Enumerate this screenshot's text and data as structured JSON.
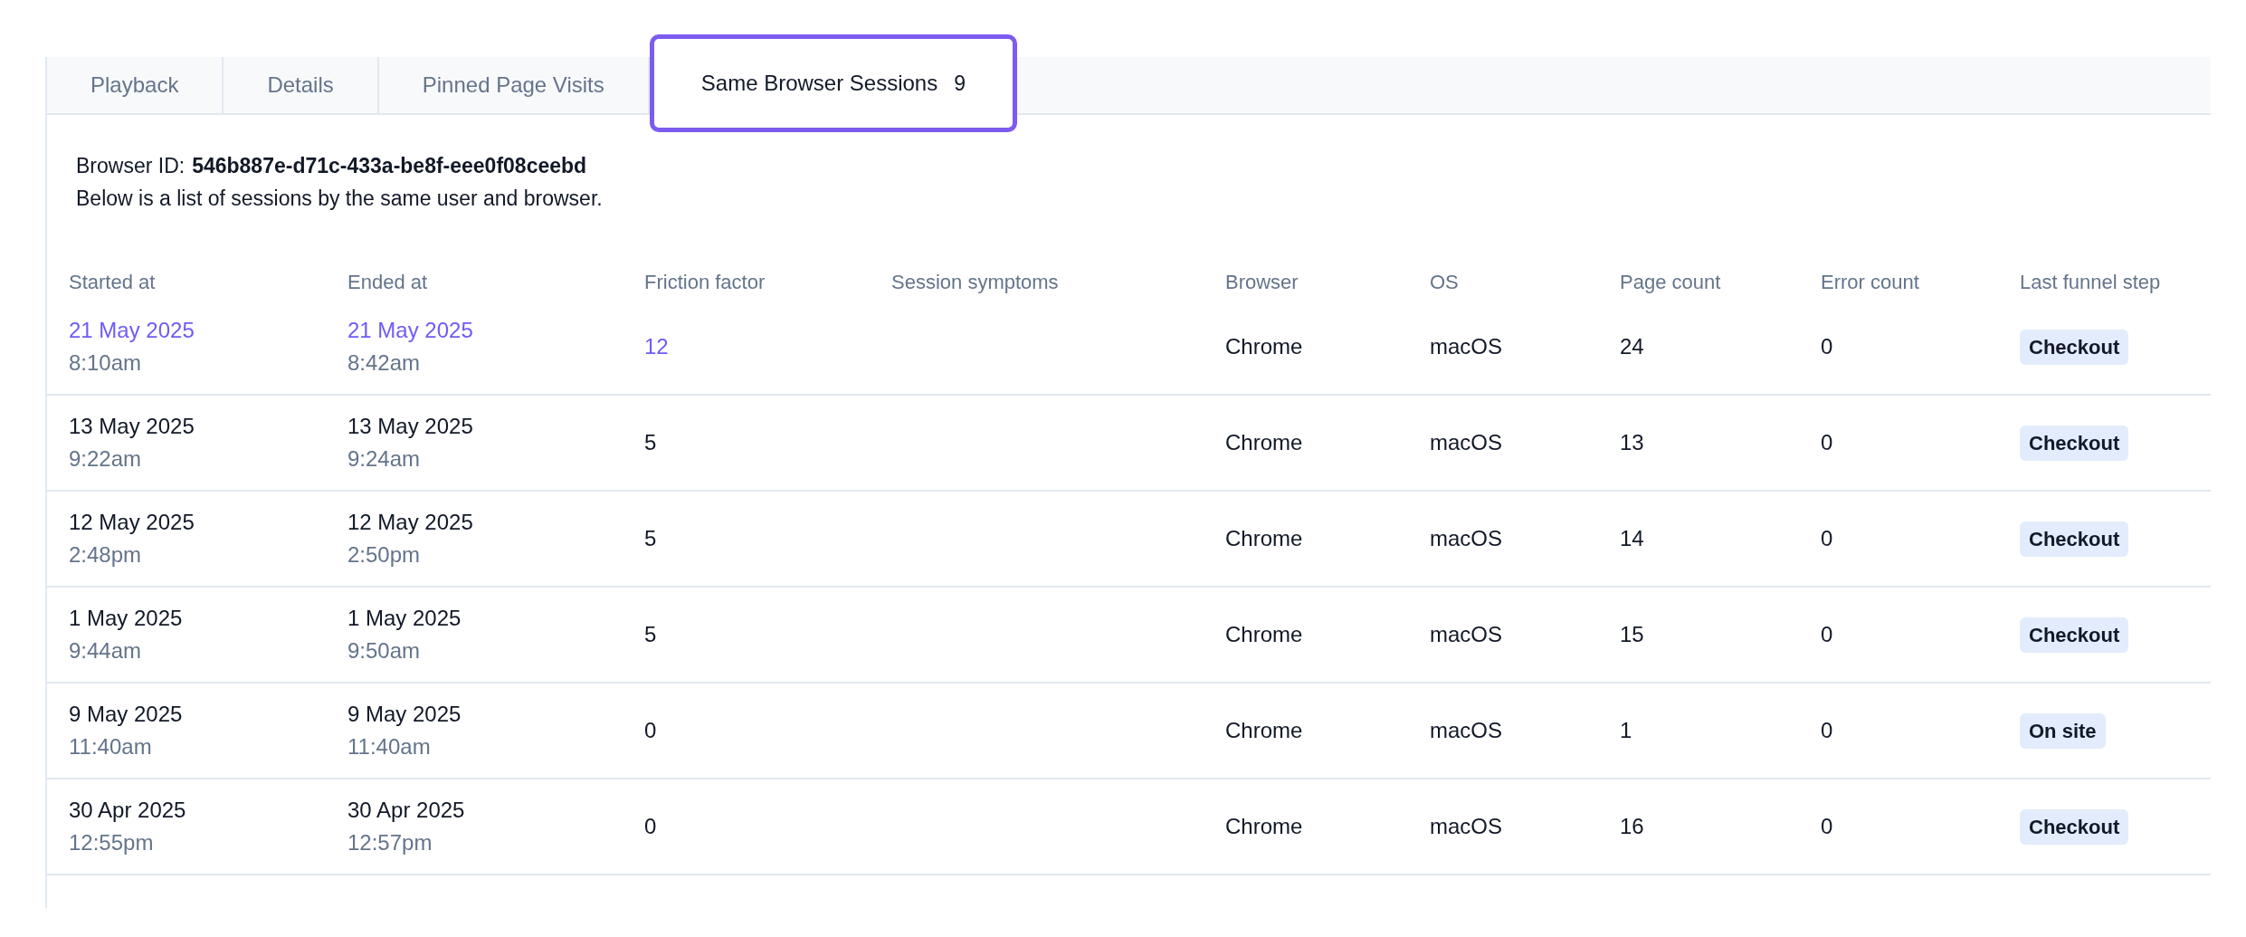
{
  "tabs": [
    {
      "label": "Playback",
      "selected": false
    },
    {
      "label": "Details",
      "selected": false
    },
    {
      "label": "Pinned Page Visits",
      "selected": false
    },
    {
      "label": "Same Browser Sessions",
      "count": "9",
      "selected": true
    }
  ],
  "browser_id": {
    "label": "Browser ID:",
    "value": "546b887e-d71c-433a-be8f-eee0f08ceebd"
  },
  "description": "Below is a list of sessions by the same user and browser.",
  "table": {
    "columns": [
      "Started at",
      "Ended at",
      "Friction factor",
      "Session symptoms",
      "Browser",
      "OS",
      "Page count",
      "Error count",
      "Last funnel step"
    ],
    "rows": [
      {
        "highlighted": true,
        "started_date": "21 May 2025",
        "started_time": "8:10am",
        "ended_date": "21 May 2025",
        "ended_time": "8:42am",
        "friction": "12",
        "browser": "Chrome",
        "os": "macOS",
        "page_count": "24",
        "error_count": "0",
        "funnel_step": "Checkout"
      },
      {
        "highlighted": false,
        "started_date": "13 May 2025",
        "started_time": "9:22am",
        "ended_date": "13 May 2025",
        "ended_time": "9:24am",
        "friction": "5",
        "browser": "Chrome",
        "os": "macOS",
        "page_count": "13",
        "error_count": "0",
        "funnel_step": "Checkout"
      },
      {
        "highlighted": false,
        "started_date": "12 May 2025",
        "started_time": "2:48pm",
        "ended_date": "12 May 2025",
        "ended_time": "2:50pm",
        "friction": "5",
        "browser": "Chrome",
        "os": "macOS",
        "page_count": "14",
        "error_count": "0",
        "funnel_step": "Checkout"
      },
      {
        "highlighted": false,
        "started_date": "1 May 2025",
        "started_time": "9:44am",
        "ended_date": "1 May 2025",
        "ended_time": "9:50am",
        "friction": "5",
        "browser": "Chrome",
        "os": "macOS",
        "page_count": "15",
        "error_count": "0",
        "funnel_step": "Checkout"
      },
      {
        "highlighted": false,
        "started_date": "9 May 2025",
        "started_time": "11:40am",
        "ended_date": "9 May 2025",
        "ended_time": "11:40am",
        "friction": "0",
        "browser": "Chrome",
        "os": "macOS",
        "page_count": "1",
        "error_count": "0",
        "funnel_step": "On site"
      },
      {
        "highlighted": false,
        "started_date": "30 Apr 2025",
        "started_time": "12:55pm",
        "ended_date": "30 Apr 2025",
        "ended_time": "12:57pm",
        "friction": "0",
        "browser": "Chrome",
        "os": "macOS",
        "page_count": "16",
        "error_count": "0",
        "funnel_step": "Checkout"
      }
    ]
  }
}
